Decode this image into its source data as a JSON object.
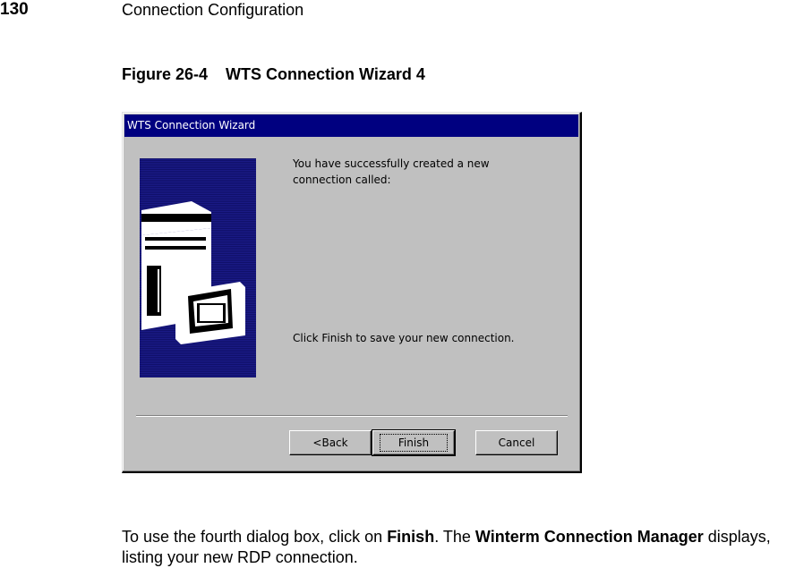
{
  "header": {
    "page_number": "130",
    "section_title": "Connection Configuration"
  },
  "figure": {
    "label": "Figure 26-4",
    "title": "WTS Connection Wizard 4"
  },
  "dialog": {
    "title": "WTS Connection Wizard",
    "message_success": "You have successfully created a new connection called:",
    "message_finish": "Click Finish to save your new connection.",
    "buttons": {
      "back": "<Back",
      "finish": "Finish",
      "cancel": "Cancel"
    }
  },
  "body": {
    "part1": "To use the fourth dialog box, click on ",
    "finish": "Finish",
    "part2": ". The ",
    "manager": "Winterm Connection Manager",
    "part3": " displays, listing your new RDP connection."
  },
  "colors": {
    "titlebar": "#000080",
    "dialog_bg": "#c0c0c0",
    "graphic_bg": "#14147a"
  },
  "icons": [
    "computer-tower-icon",
    "monitor-icon"
  ]
}
